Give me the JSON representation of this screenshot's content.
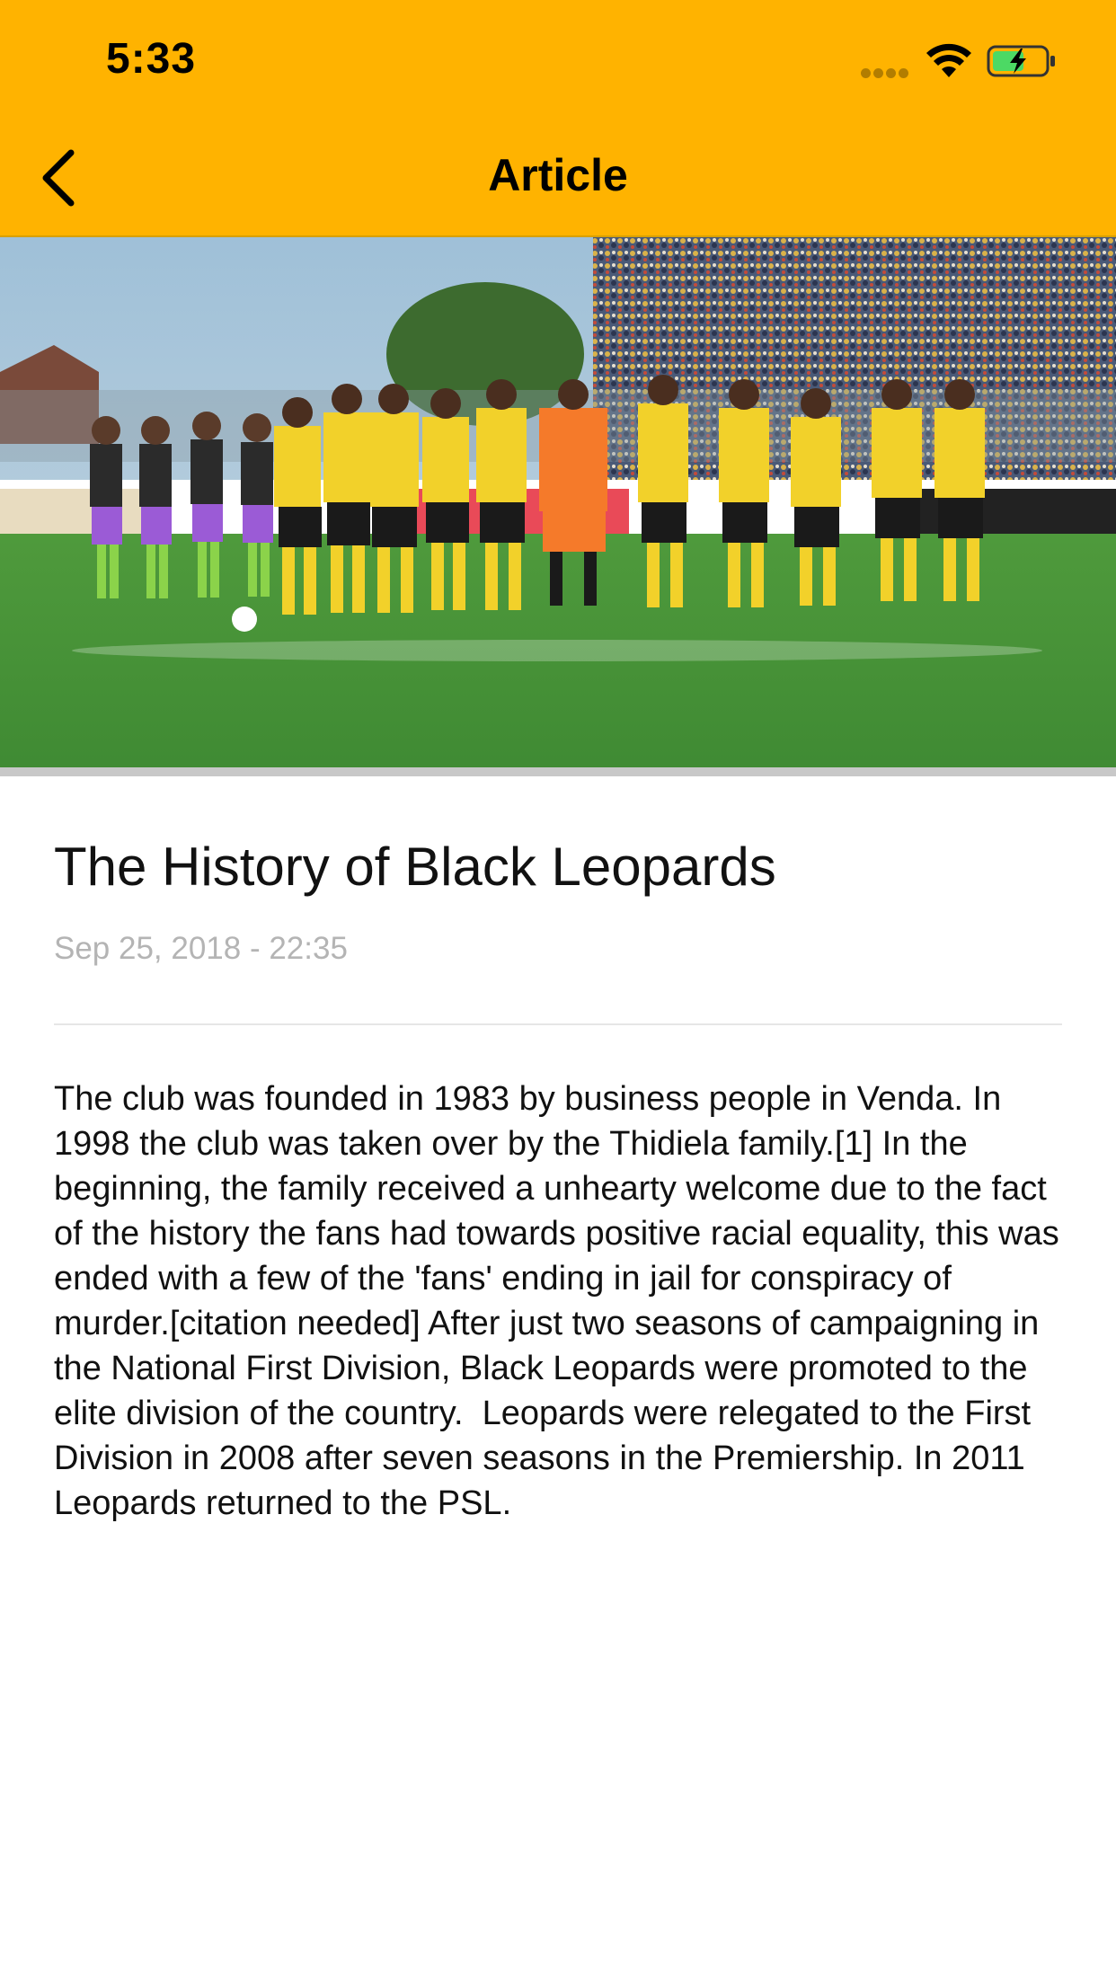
{
  "status_bar": {
    "time": "5:33"
  },
  "nav": {
    "title": "Article",
    "back_icon": "chevron-left-icon"
  },
  "hero": {
    "image_alt": "Black Leopards players lined up on the pitch"
  },
  "article": {
    "title": "The History of Black Leopards",
    "date": "Sep 25, 2018 - 22:35",
    "body": "The club was founded in 1983 by business people in Venda. In 1998 the club was taken over by the Thidiela family.[1] In the beginning, the family received a unhearty welcome due to the fact of the history the fans had towards positive racial equality, this was ended with a few of the 'fans' ending in jail for conspiracy of murder.[citation needed] After just two seasons of campaigning in the National First Division, Black Leopards were promoted to the elite division of the country.  Leopards were relegated to the First Division in 2008 after seven seasons in the Premiership. In 2011 Leopards returned to the PSL."
  },
  "colors": {
    "accent": "#FFB300",
    "text": "#111111",
    "muted": "#B4B4B4"
  }
}
